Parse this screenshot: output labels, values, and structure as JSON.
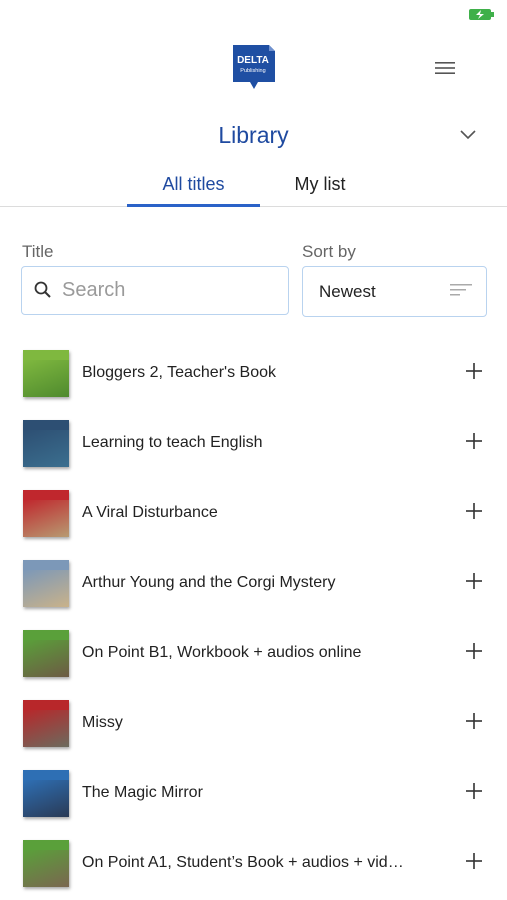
{
  "status": {
    "battery_color": "#3fb04a"
  },
  "header": {
    "logo_line1": "DELTA",
    "logo_line2": "Publishing",
    "library_title": "Library"
  },
  "tabs": [
    {
      "label": "All titles",
      "active": true
    },
    {
      "label": "My list",
      "active": false
    }
  ],
  "filters": {
    "title_label": "Title",
    "search_placeholder": "Search",
    "sort_label": "Sort by",
    "sort_value": "Newest"
  },
  "books": [
    {
      "title": "Bloggers 2, Teacher's Book",
      "cover_top": "#7fb83f",
      "cover_bottom": "#4f8a2e"
    },
    {
      "title": "Learning to teach English",
      "cover_top": "#2d4f73",
      "cover_bottom": "#3b6f8f"
    },
    {
      "title": "A Viral Disturbance",
      "cover_top": "#c0272d",
      "cover_bottom": "#b79b72"
    },
    {
      "title": "Arthur Young and the Corgi Mystery",
      "cover_top": "#7c98b8",
      "cover_bottom": "#c9b28a"
    },
    {
      "title": "On Point B1, Workbook + audios online",
      "cover_top": "#5aa03a",
      "cover_bottom": "#6d5a44"
    },
    {
      "title": "Missy",
      "cover_top": "#b8272a",
      "cover_bottom": "#6b6b5e"
    },
    {
      "title": "The Magic Mirror",
      "cover_top": "#2e6fb4",
      "cover_bottom": "#2a3a55"
    },
    {
      "title": "On Point A1, Student’s Book + audios + vide…",
      "cover_top": "#5aa03a",
      "cover_bottom": "#7a6650"
    }
  ],
  "colors": {
    "accent": "#1f4aa0",
    "tab_underline": "#2a62c8",
    "input_border": "#b9d3ef"
  }
}
